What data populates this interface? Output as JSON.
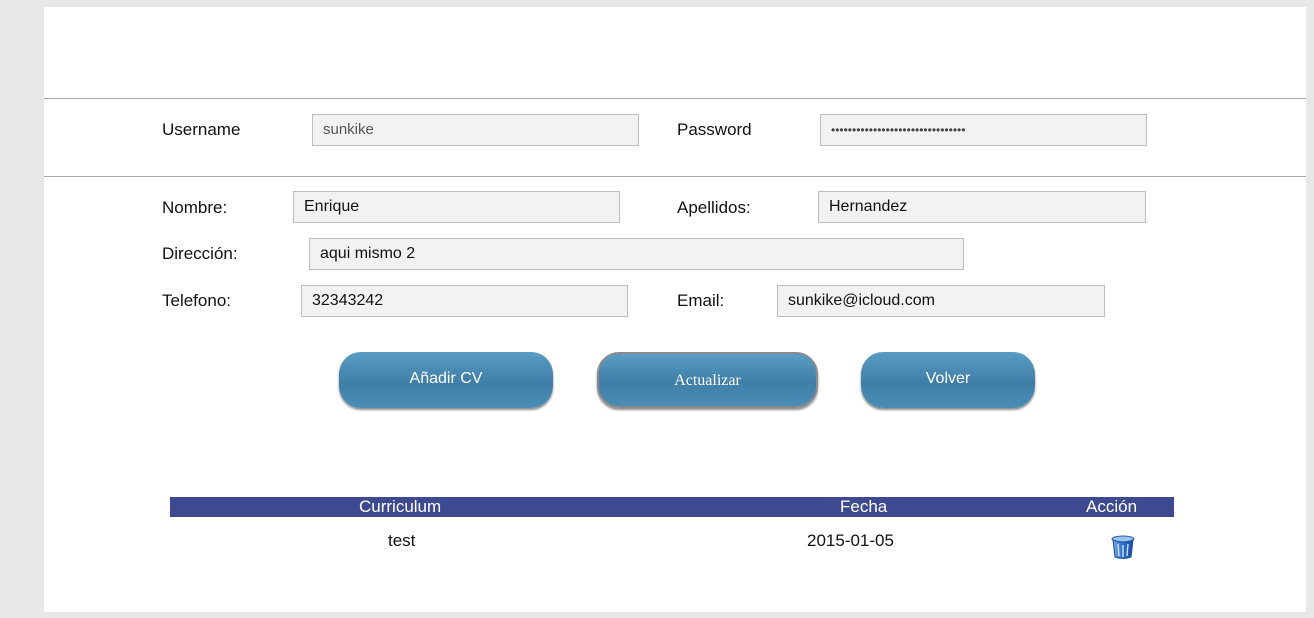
{
  "account": {
    "username_label": "Username",
    "username_value": "sunkike",
    "password_label": "Password",
    "password_value": "••••••••••••••••••••••••••••••••"
  },
  "profile": {
    "nombre_label": "Nombre:",
    "nombre_value": "Enrique",
    "apellidos_label": "Apellidos:",
    "apellidos_value": "Hernandez",
    "direccion_label": "Dirección:",
    "direccion_value": "aqui mismo 2",
    "telefono_label": "Telefono:",
    "telefono_value": "32343242",
    "email_label": "Email:",
    "email_value": "sunkike@icloud.com"
  },
  "buttons": {
    "add_cv": "Añadir CV",
    "update": "Actualizar",
    "back": "Volver"
  },
  "table": {
    "headers": [
      "Curriculum",
      "Fecha",
      "Acción"
    ],
    "rows": [
      {
        "curriculum": "test",
        "fecha": "2015-01-05",
        "action_icon": "trash-icon"
      }
    ]
  },
  "colors": {
    "header_bar": "#3d4a8f",
    "button": "#4a8ab2"
  }
}
